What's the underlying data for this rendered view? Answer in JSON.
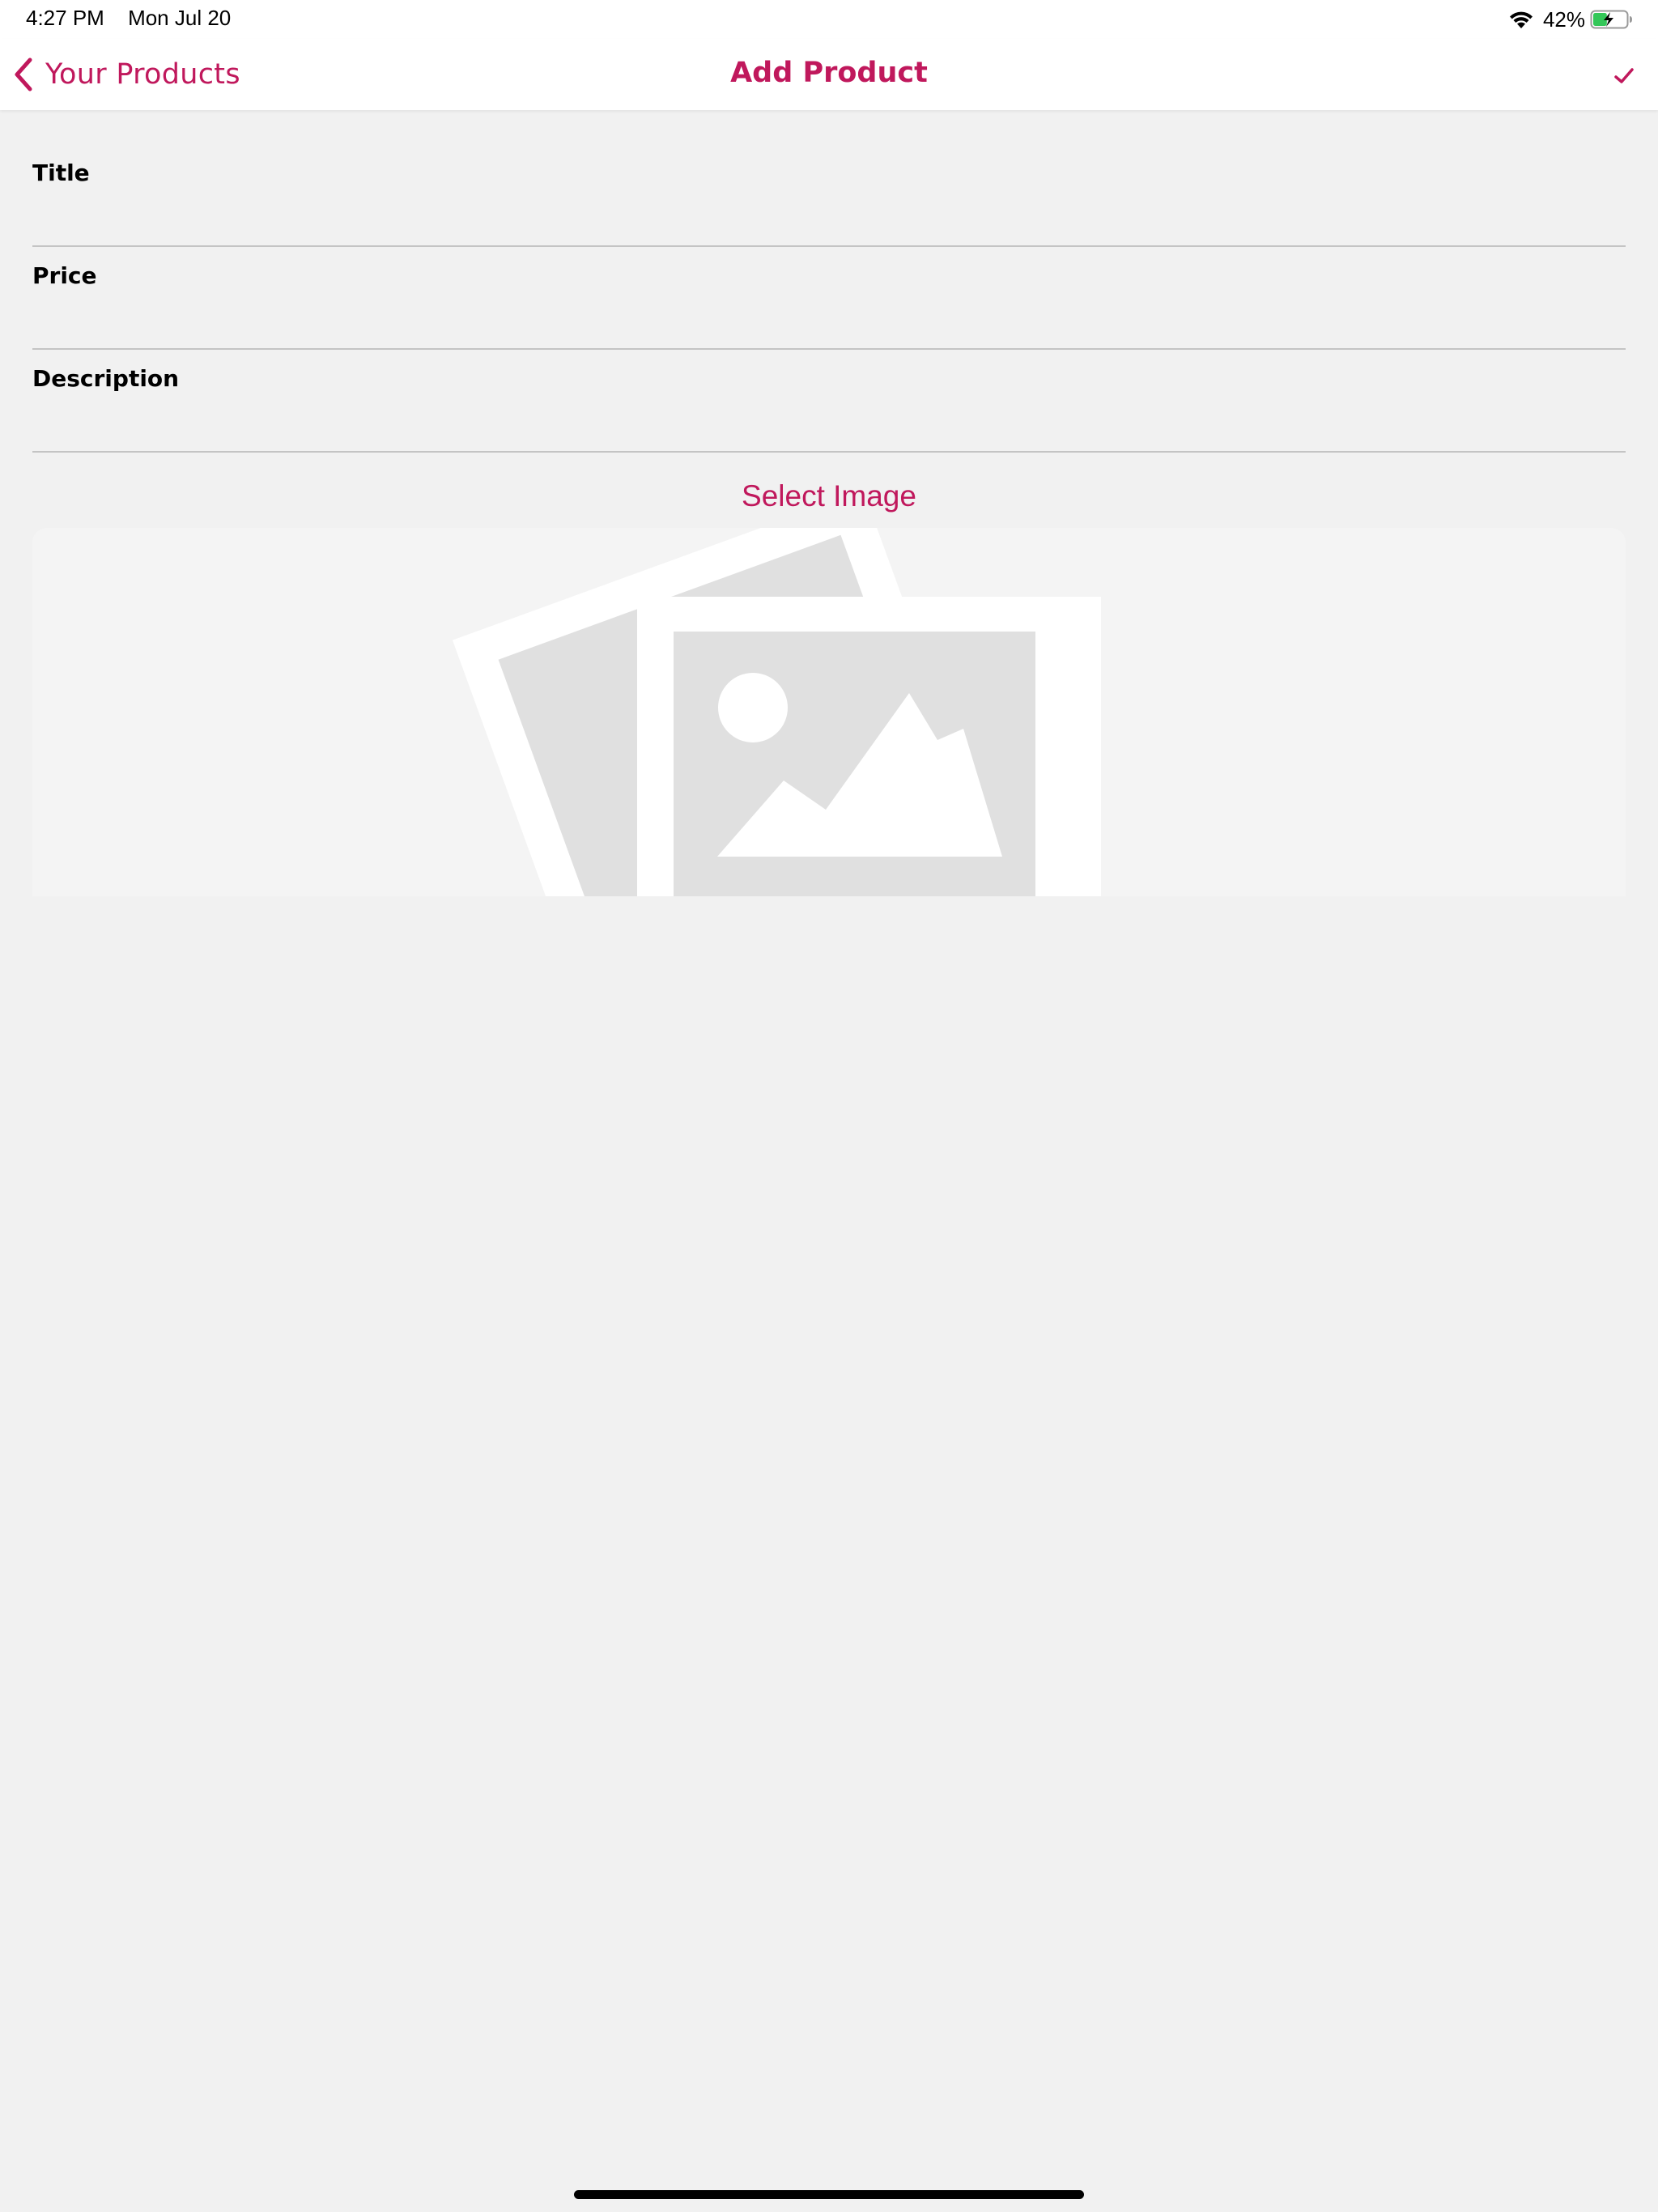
{
  "status_bar": {
    "time": "4:27 PM",
    "date": "Mon Jul 20",
    "battery_percent": "42%",
    "battery_level": 0.42,
    "charging": true
  },
  "nav": {
    "back_label": "Your Products",
    "title": "Add Product",
    "save_icon": "checkmark-icon"
  },
  "form": {
    "fields": [
      {
        "label": "Title",
        "value": ""
      },
      {
        "label": "Price",
        "value": ""
      },
      {
        "label": "Description",
        "value": ""
      }
    ],
    "select_image_label": "Select Image",
    "image_placeholder_icon": "image-placeholder-icon"
  },
  "colors": {
    "accent": "#c0185c",
    "background": "#f1f1f1",
    "battery_fill": "#34c759"
  }
}
